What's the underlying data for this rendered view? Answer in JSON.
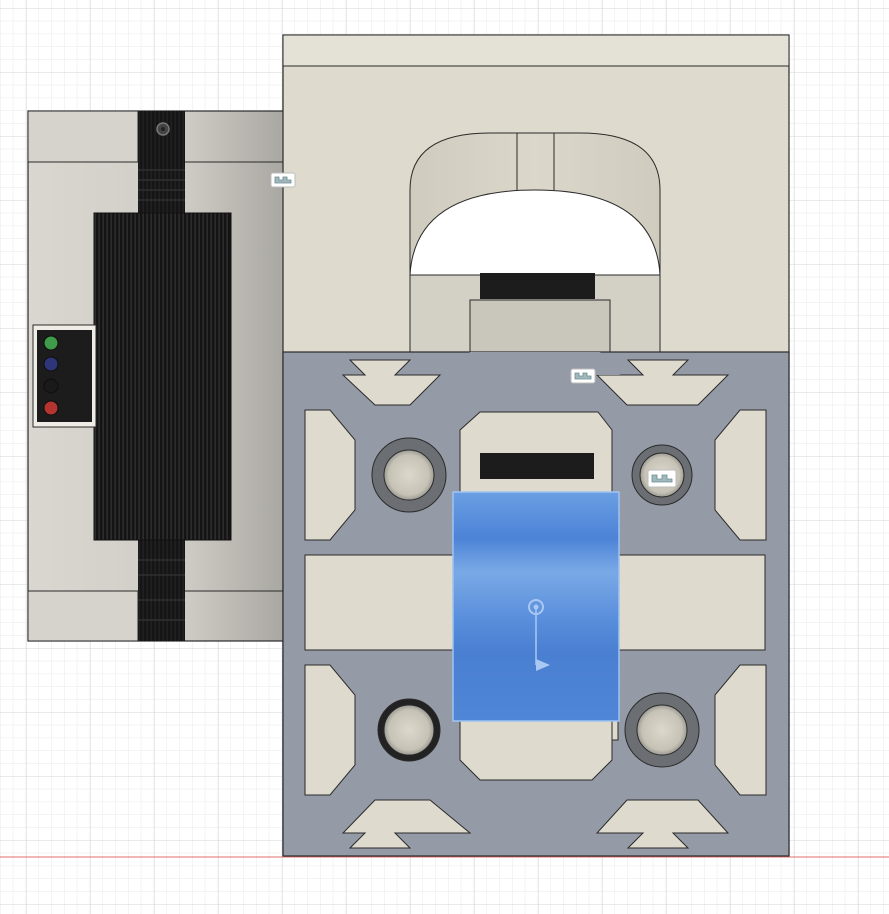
{
  "viewport": {
    "view": "top",
    "grid_visible": true
  },
  "colors": {
    "background": "#ffffff",
    "grid_minor": "#e9e9e9",
    "grid_major": "#d6d6d6",
    "axis_x": "#e36c6c",
    "body_beige": "#dedacd",
    "extrusion_gray": "#959ba6",
    "heatsink_black": "#1a1a1a",
    "selection_blue": "#5f97de",
    "outline": "#2a2a2a"
  },
  "led_panel": {
    "leds": [
      {
        "color": "#3f9a4a",
        "name": "green-led"
      },
      {
        "color": "#2e3578",
        "name": "blue-led"
      },
      {
        "color": "#1a1a1a",
        "name": "black-led"
      },
      {
        "color": "#b5342f",
        "name": "red-led"
      }
    ]
  },
  "joint_markers": [
    {
      "name": "joint-marker-left"
    },
    {
      "name": "joint-marker-top"
    },
    {
      "name": "joint-marker-bore"
    }
  ],
  "icons": {
    "selection_origin": "origin-point-icon",
    "selection_direction": "direction-arrow-icon",
    "joint_marker": "joint-marker-icon"
  }
}
